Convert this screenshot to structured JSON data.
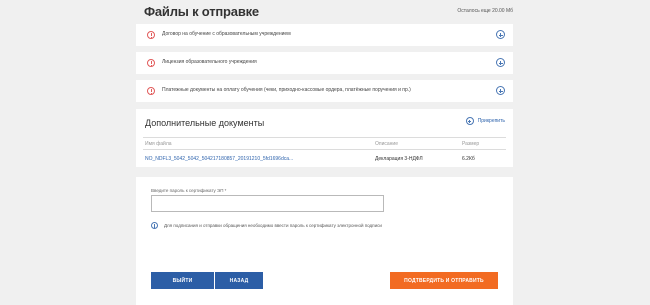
{
  "header": {
    "title": "Файлы к отправке",
    "quota": "Осталось еще 20.00 Мб"
  },
  "required_docs": [
    {
      "label": "Договор на обучение с образовательным учреждением"
    },
    {
      "label": "Лицензия образовательного учреждения"
    },
    {
      "label": "Платежные документы на оплату обучения (чеки, приходно-кассовые ордера, платёжные поручения и пр.)"
    }
  ],
  "extra_docs": {
    "title": "Дополнительные документы",
    "attach_label": "Прикрепить",
    "columns": {
      "name": "Имя файла",
      "description": "Описание",
      "size": "Размер"
    },
    "rows": [
      {
        "name": "NO_NDFL3_5042_5042_504217180857_20191210_5fd1696dca...",
        "description": "Декларация 3-НДФЛ",
        "size": "6.2Кб"
      }
    ]
  },
  "signature": {
    "password_label": "Введите пароль к сертификату ЭП *",
    "password_value": "",
    "info_text": "Для подписания и отправки обращения необходимо ввести пароль к сертификату электронной подписи"
  },
  "buttons": {
    "exit": "ВЫЙТИ",
    "back": "НАЗАД",
    "submit": "ПОДТВЕРДИТЬ И ОТПРАВИТЬ"
  },
  "colors": {
    "primary": "#2c5ea6",
    "accent": "#f26b22",
    "warning": "#e15b5b",
    "link": "#2f64ad"
  }
}
